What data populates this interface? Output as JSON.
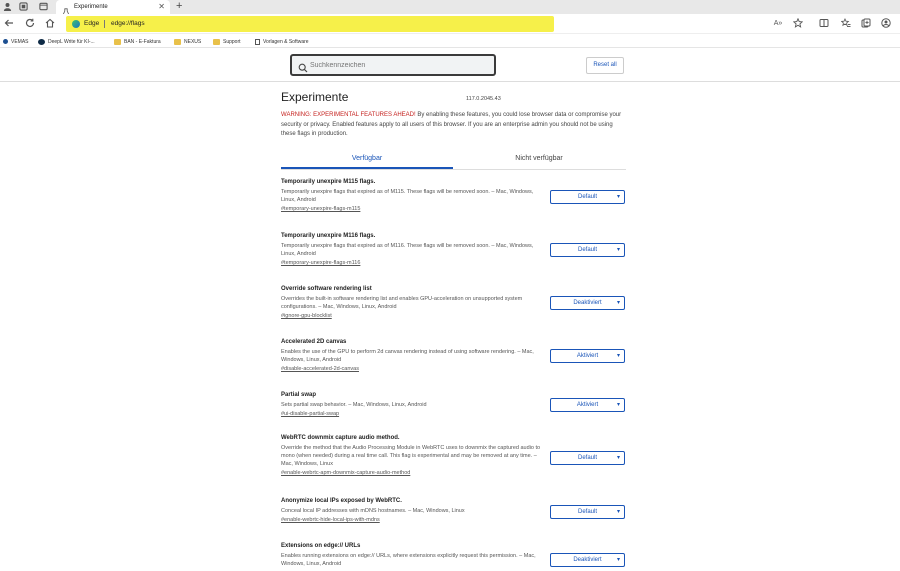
{
  "browser": {
    "tab_title": "Experimente",
    "tab_close": "✕",
    "new_tab": "+",
    "omnibox_label": "Edge",
    "url": "edge://flags",
    "icons": {
      "profile": "profile-icon",
      "back": "back-icon",
      "refresh": "refresh-icon",
      "home": "home-icon"
    }
  },
  "favorites": [
    {
      "label": "VEMAS",
      "icon": "vemas-icon"
    },
    {
      "label": "DeepL Write für KI-...",
      "icon": "deepl-icon"
    },
    {
      "label": "BAN - E-Faktura",
      "icon": "folder-icon"
    },
    {
      "label": "NEXUS",
      "icon": "folder-icon"
    },
    {
      "label": "Support",
      "icon": "folder-icon"
    },
    {
      "label": "Vorlagen & Software",
      "icon": "page-icon"
    }
  ],
  "header": {
    "search_placeholder": "Suchkennzeichen",
    "reset_label": "Reset all"
  },
  "main": {
    "title": "Experimente",
    "version": "117.0.2045.43",
    "warning_red": "WARNING: EXPERIMENTAL FEATURES AHEAD!",
    "warning_text": " By enabling these features, you could lose browser data or compromise your security or privacy. Enabled features apply to all users of this browser. If you are an enterprise admin you should not be using these flags in production.",
    "tabs": [
      "Verfügbar",
      "Nicht verfügbar"
    ]
  },
  "experiments": [
    {
      "title": "Temporarily unexpire M115 flags.",
      "desc": "Temporarily unexpire flags that expired as of M115. These flags will be removed soon. – Mac, Windows, Linux, Android",
      "anchor": "#temporary-unexpire-flags-m115",
      "value": "Default"
    },
    {
      "title": "Temporarily unexpire M116 flags.",
      "desc": "Temporarily unexpire flags that expired as of M116. These flags will be removed soon. – Mac, Windows, Linux, Android",
      "anchor": "#temporary-unexpire-flags-m116",
      "value": "Default"
    },
    {
      "title": "Override software rendering list",
      "desc": "Overrides the built-in software rendering list and enables GPU-acceleration on unsupported system configurations. – Mac, Windows, Linux, Android",
      "anchor": "#ignore-gpu-blocklist",
      "value": "Deaktiviert"
    },
    {
      "title": "Accelerated 2D canvas",
      "desc": "Enables the use of the GPU to perform 2d canvas rendering instead of using software rendering. – Mac, Windows, Linux, Android",
      "anchor": "#disable-accelerated-2d-canvas",
      "value": "Aktiviert"
    },
    {
      "title": "Partial swap",
      "desc": "Sets partial swap behavior. – Mac, Windows, Linux, Android",
      "anchor": "#ui-disable-partial-swap",
      "value": "Aktiviert"
    },
    {
      "title": "WebRTC downmix capture audio method.",
      "desc": "Override the method that the Audio Processing Module in WebRTC uses to downmix the captured audio to mono (when needed) during a real time call. This flag is experimental and may be removed at any time. – Mac, Windows, Linux",
      "anchor": "#enable-webrtc-apm-downmix-capture-audio-method",
      "value": "Default"
    },
    {
      "title": "Anonymize local IPs exposed by WebRTC.",
      "desc": "Conceal local IP addresses with mDNS hostnames. – Mac, Windows, Linux",
      "anchor": "#enable-webrtc-hide-local-ips-with-mdns",
      "value": "Default"
    },
    {
      "title": "Extensions on edge:// URLs",
      "desc": "Enables running extensions on edge:// URLs, where extensions explicitly request this permission. – Mac, Windows, Linux, Android",
      "anchor": "",
      "value": "Deaktiviert"
    }
  ]
}
